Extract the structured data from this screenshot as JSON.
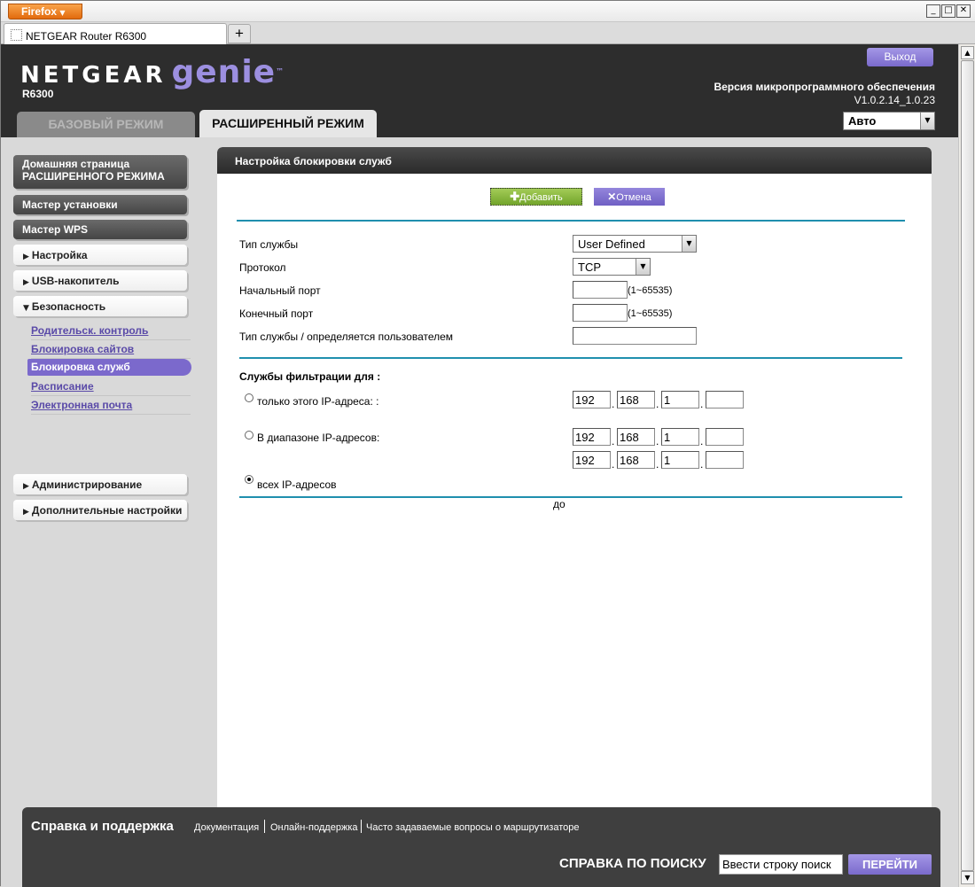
{
  "browser": {
    "menu_label": "Firefox",
    "tab_title": "NETGEAR Router R6300",
    "new_tab": "+",
    "minimize": "_",
    "maximize": "□",
    "close": "✕"
  },
  "header": {
    "brand": "NETGEAR",
    "product": "genie",
    "trademark": "™",
    "model": "R6300",
    "logout_label": "Выход",
    "firmware_label": "Версия микропрограммного обеспечения",
    "firmware_version": "V1.0.2.14_1.0.23",
    "tab_basic": "БАЗОВЫЙ РЕЖИМ",
    "tab_advanced": "РАСШИРЕННЫЙ РЕЖИМ",
    "language_value": "Авто"
  },
  "sidebar": {
    "home_line1": "Домашняя страница",
    "home_line2": "РАСШИРЕННОГО РЕЖИМА",
    "setup_wizard": "Мастер установки",
    "wps_wizard": "Мастер WPS",
    "setup": "Настройка",
    "usb": "USB-накопитель",
    "security": "Безопасность",
    "security_items": [
      "Родительск. контроль",
      "Блокировка сайтов",
      "Блокировка служб",
      "Расписание",
      "Электронная почта"
    ],
    "admin": "Администрирование",
    "advanced_setup": "Дополнительные настройки"
  },
  "panel": {
    "title": "Настройка блокировки служб",
    "add_label": "Добавить",
    "cancel_label": "Отмена",
    "service_type_label": "Тип службы",
    "service_type_value": "User Defined",
    "protocol_label": "Протокол",
    "protocol_value": "TCP",
    "start_port_label": "Начальный порт",
    "start_port_value": "",
    "end_port_label": "Конечный порт",
    "end_port_value": "",
    "port_range_hint": "(1~65535)",
    "user_service_label": "Тип службы / определяется пользователем",
    "user_service_value": "",
    "filter_heading": "Службы фильтрации для :",
    "only_ip_label": "только этого IP-адреса: :",
    "range_label": "В диапазоне IP-адресов:",
    "to_label": "до",
    "all_ip_label": "всех IP-адресов",
    "ip_only": [
      "192",
      "168",
      "1",
      ""
    ],
    "ip_range_from": [
      "192",
      "168",
      "1",
      ""
    ],
    "ip_range_to": [
      "192",
      "168",
      "1",
      ""
    ],
    "selected_scope": "all"
  },
  "footer": {
    "title": "Справка и поддержка",
    "links": [
      "Документация",
      "Онлайн-поддержка",
      "Часто задаваемые вопросы о маршрутизаторе"
    ],
    "search_label": "СПРАВКА ПО ПОИСКУ",
    "search_value": "Ввести строку поиск",
    "go_label": "ПЕРЕЙТИ"
  },
  "colors": {
    "accent_purple": "#7b69cc",
    "accent_green": "#72a52b",
    "divider_teal": "#1f8fae",
    "header_dark": "#2d2d2d"
  }
}
